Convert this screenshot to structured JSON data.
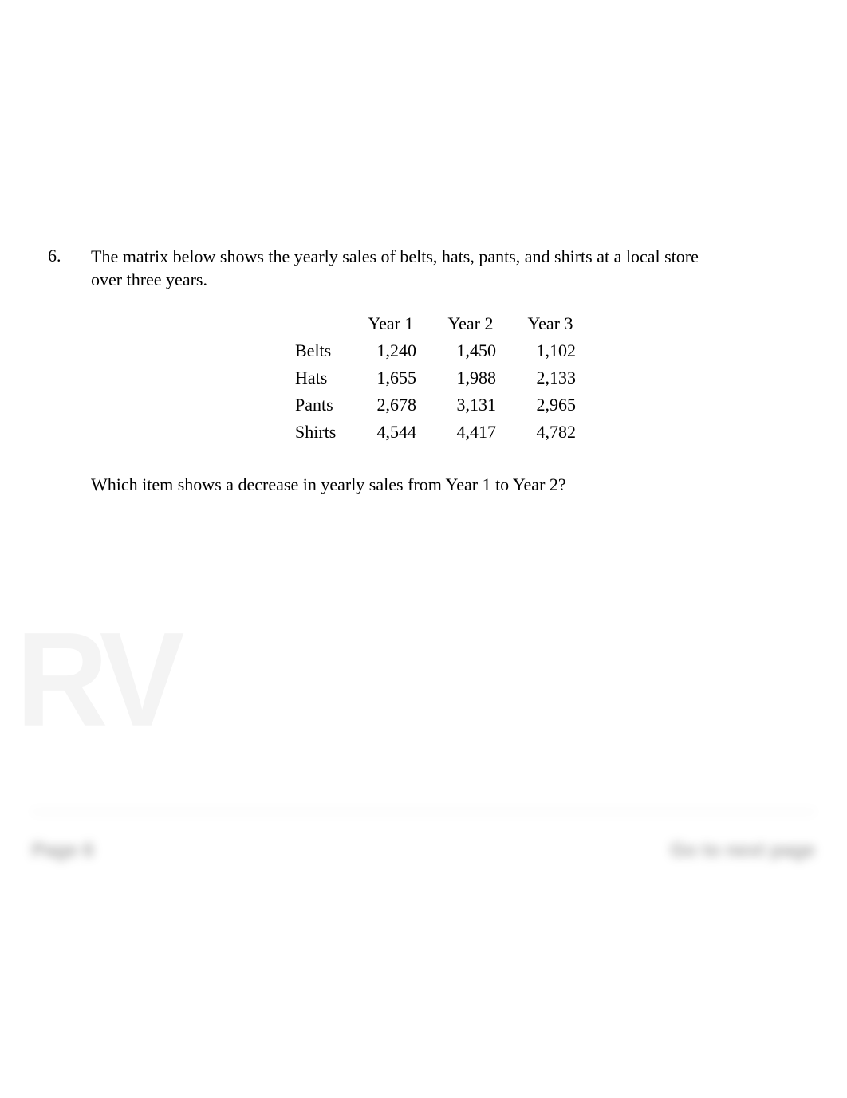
{
  "question": {
    "number": "6.",
    "stem": "The matrix below shows the yearly sales of belts, hats, pants, and shirts at a local store over three years.",
    "follow_up": "Which item shows a decrease in yearly sales from Year 1 to Year 2?"
  },
  "chart_data": {
    "type": "table",
    "columns": [
      "Year 1",
      "Year 2",
      "Year 3"
    ],
    "rows": [
      {
        "label": "Belts",
        "values": [
          "1,240",
          "1,450",
          "1,102"
        ]
      },
      {
        "label": "Hats",
        "values": [
          "1,655",
          "1,988",
          "2,133"
        ]
      },
      {
        "label": "Pants",
        "values": [
          "2,678",
          "3,131",
          "2,965"
        ]
      },
      {
        "label": "Shirts",
        "values": [
          "4,544",
          "4,417",
          "4,782"
        ]
      }
    ]
  },
  "watermark": "RV",
  "footer": {
    "left": "Page 6",
    "right": "Go to next page"
  }
}
